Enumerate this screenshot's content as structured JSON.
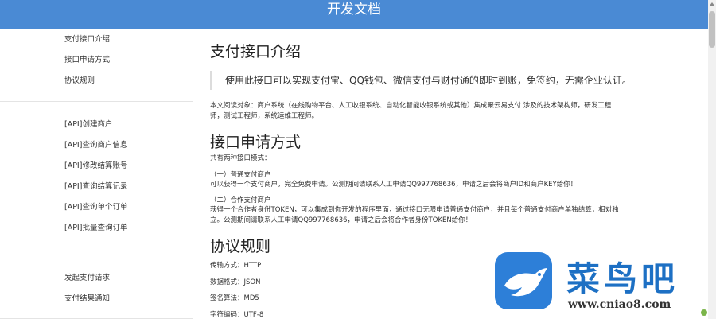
{
  "header": {
    "title": "开发文档"
  },
  "sidebar": {
    "groups": [
      {
        "items": [
          {
            "label": "支付接口介绍"
          },
          {
            "label": "接口申请方式"
          },
          {
            "label": "协议规则"
          }
        ]
      },
      {
        "items": [
          {
            "label": "[API]创建商户"
          },
          {
            "label": "[API]查询商户信息"
          },
          {
            "label": "[API]修改结算账号"
          },
          {
            "label": "[API]查询结算记录"
          },
          {
            "label": "[API]查询单个订单"
          },
          {
            "label": "[API]批量查询订单"
          }
        ]
      },
      {
        "items": [
          {
            "label": "发起支付请求"
          },
          {
            "label": "支付结果通知"
          }
        ]
      }
    ]
  },
  "content": {
    "intro": {
      "title": "支付接口介绍",
      "quote": "使用此接口可以实现支付宝、QQ钱包、微信支付与财付通的即时到账，免签约，无需企业认证。",
      "audience_line1": "本文阅读对象：商户系统（在线购物平台、人工收银系统、自动化智能收银系统或其他）集成聚云易支付 涉及的技术架构师，研发工程",
      "audience_line2": "师，测试工程师，系统运维工程师。"
    },
    "apply": {
      "title": "接口申请方式",
      "lead": "共有两种接口模式：",
      "mode1_title": "（一）普通支付商户",
      "mode1_desc": "可以获得一个支付商户，完全免费申请。公测期间请联系人工申请QQ997768636，申请之后会将商户ID和商户KEY给你！",
      "mode2_title": "（二）合作支付商户",
      "mode2_desc_line1": "获得一个合作者身份TOKEN，可以集成到你开发的程序里面，通过接口无限申请普通支付商户，并且每个普通支付商户单独结算，相对独",
      "mode2_desc_line2": "立。公测期间请联系人工申请QQ997768636，申请之后会将合作者身份TOKEN给你！"
    },
    "protocol": {
      "title": "协议规则",
      "transport": "传输方式：HTTP",
      "format": "数据格式：JSON",
      "sign": "签名算法：MD5",
      "charset": "字符编码：UTF-8"
    }
  },
  "watermark": {
    "logo_text": "菜鸟吧",
    "url": "www.cniao8.com"
  },
  "colors": {
    "header_bg": "#4a8ad4",
    "watermark_blue": "#1d70c4"
  },
  "icons": {
    "watermark_logo": "bird-logo-icon",
    "corner": "corner-badge-icon"
  }
}
